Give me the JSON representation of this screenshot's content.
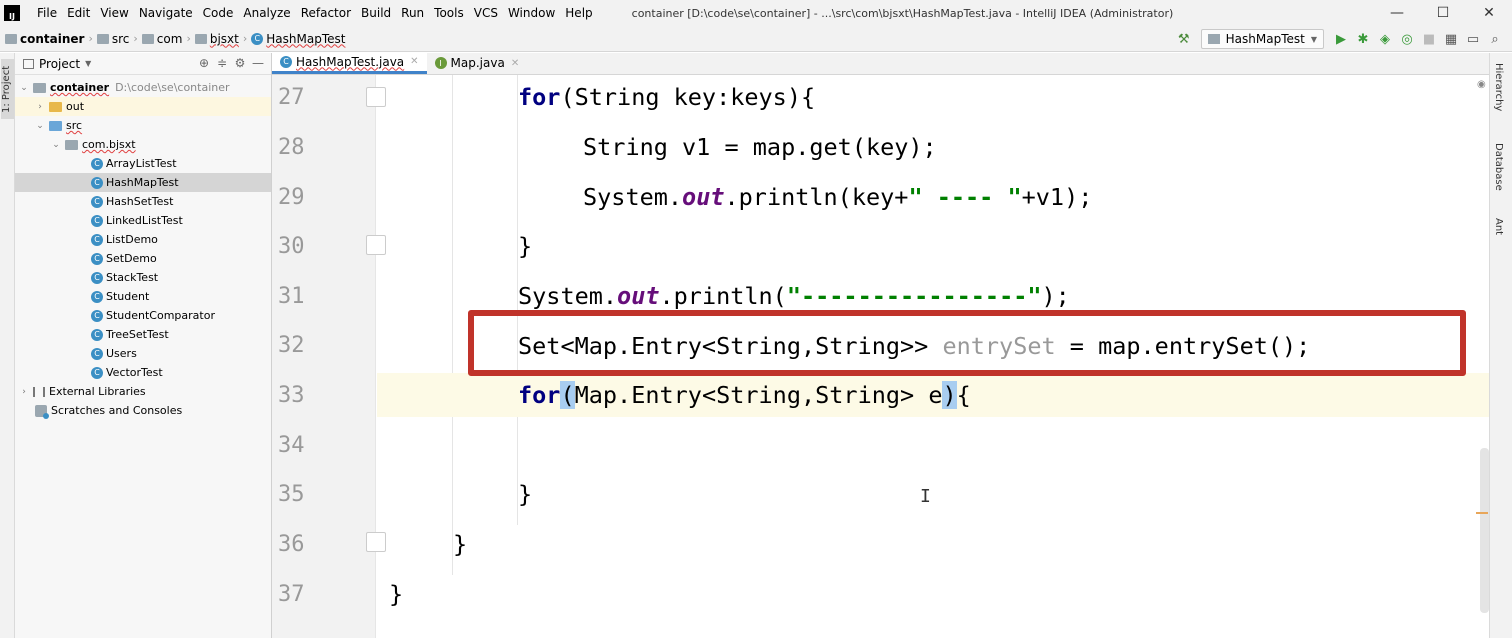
{
  "window": {
    "logo": "IJ",
    "menu": [
      "File",
      "Edit",
      "View",
      "Navigate",
      "Code",
      "Analyze",
      "Refactor",
      "Build",
      "Run",
      "Tools",
      "VCS",
      "Window",
      "Help"
    ],
    "title": "container [D:\\code\\se\\container] - ...\\src\\com\\bjsxt\\HashMapTest.java - IntelliJ IDEA (Administrator)",
    "controls": {
      "minimize": "—",
      "maximize": "☐",
      "close": "✕"
    }
  },
  "breadcrumb": [
    "container",
    "src",
    "com",
    "bjsxt",
    "HashMapTest"
  ],
  "toolbar": {
    "run_config": "HashMapTest"
  },
  "left_strip": {
    "tab": "1: Project"
  },
  "project": {
    "title": "Project",
    "root": {
      "name": "container",
      "path": "D:\\code\\se\\container"
    },
    "out": "out",
    "src": "src",
    "package": "com.bjsxt",
    "classes": [
      "ArrayListTest",
      "HashMapTest",
      "HashSetTest",
      "LinkedListTest",
      "ListDemo",
      "SetDemo",
      "StackTest",
      "Student",
      "StudentComparator",
      "TreeSetTest",
      "Users",
      "VectorTest"
    ],
    "external": "External Libraries",
    "scratches": "Scratches and Consoles"
  },
  "tabs": [
    {
      "label": "HashMapTest.java",
      "active": true
    },
    {
      "label": "Map.java",
      "active": false
    }
  ],
  "editor": {
    "line_numbers": [
      "27",
      "28",
      "29",
      "30",
      "31",
      "32",
      "33",
      "34",
      "35",
      "36",
      "37"
    ],
    "lines": {
      "l27": {
        "kw": "for",
        "rest": "(String key:keys){"
      },
      "l28": "String v1 = map.get(key);",
      "l29": {
        "a": "System.",
        "b": "out",
        "c": ".println(key+",
        "d": "\" ---- \"",
        "e": "+v1);"
      },
      "l30": "}",
      "l31": {
        "a": "System.",
        "b": "out",
        "c": ".println(",
        "d": "\"----------------\"",
        "e": ");"
      },
      "l32": {
        "a": "Set<Map.Entry<String,String>> ",
        "b": "entrySet",
        "c": " = map.entrySet();"
      },
      "l33": {
        "kw": "for",
        "a": "(",
        "b": "Map.Entry<String,String> e",
        "c": ")",
        "d": "{"
      },
      "l35": "}",
      "l36": "}",
      "l37": "}"
    }
  },
  "right_strip": [
    "Hierarchy",
    "Database",
    "Ant"
  ],
  "colors": {
    "highlight_box": "#c0332a",
    "keyword": "#000080",
    "string": "#008000",
    "static_field": "#660e7a"
  }
}
